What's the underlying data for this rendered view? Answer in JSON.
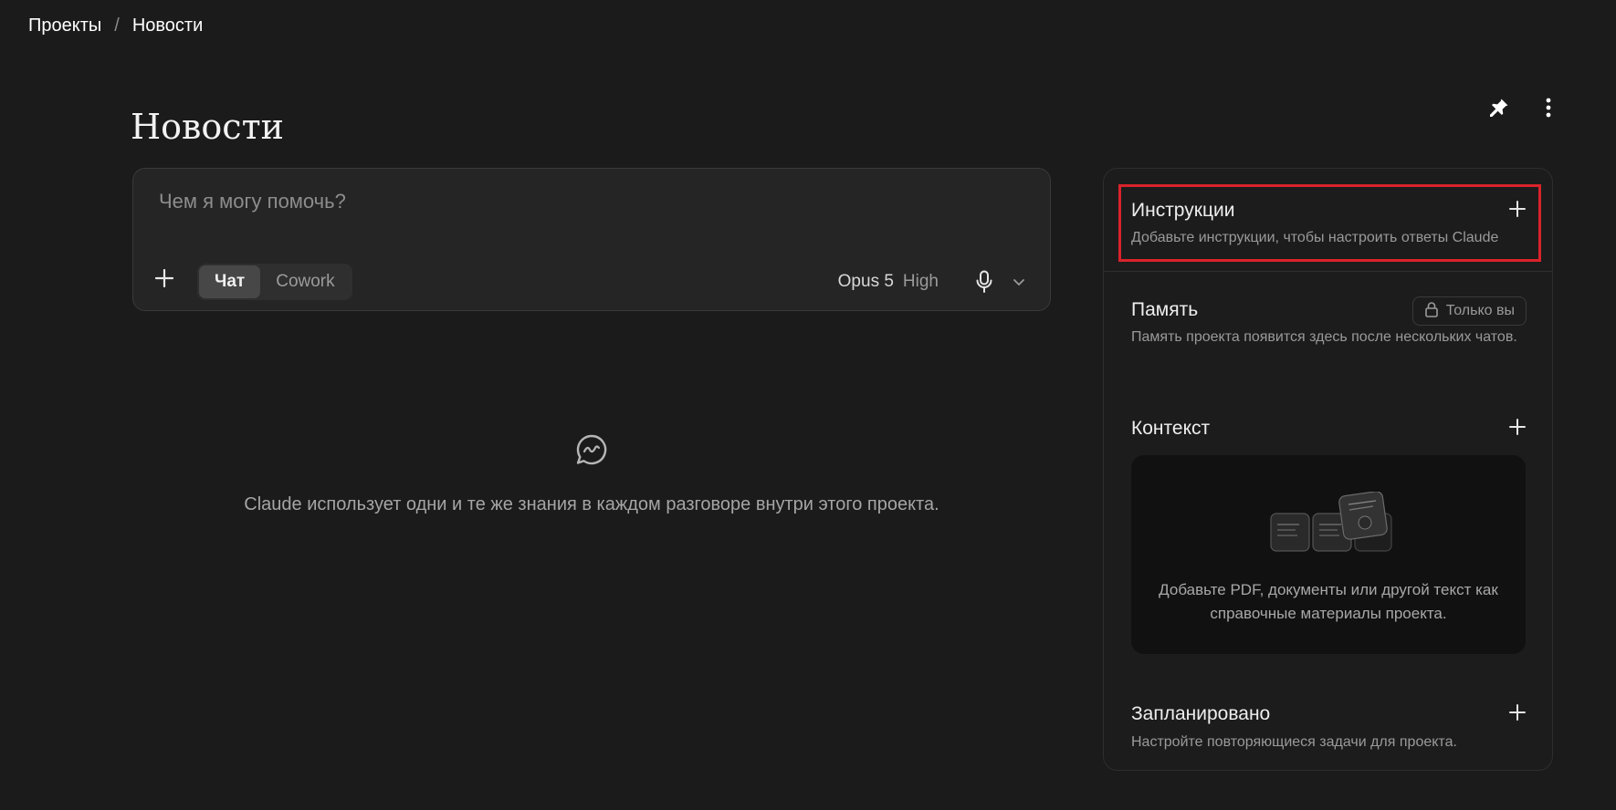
{
  "breadcrumb": {
    "items": [
      "Проекты",
      "Новости"
    ],
    "separator": "/"
  },
  "page": {
    "title": "Новости"
  },
  "header_actions": {
    "pin_icon": "pin-icon",
    "more_icon": "more-vertical-icon"
  },
  "composer": {
    "placeholder": "Чем я могу помочь?",
    "modes": [
      "Чат",
      "Cowork"
    ],
    "active_mode": "Чат",
    "model": "Opus 5",
    "effort": "High"
  },
  "empty_state": {
    "text": "Claude использует одни и те же знания в каждом разговоре внутри этого проекта."
  },
  "panel": {
    "instructions": {
      "title": "Инструкции",
      "description": "Добавьте инструкции, чтобы настроить ответы Claude"
    },
    "memory": {
      "title": "Память",
      "badge": "Только вы",
      "description": "Память проекта появится здесь после нескольких чатов."
    },
    "context": {
      "title": "Контекст",
      "card_text": "Добавьте PDF, документы или другой текст как справочные материалы проекта."
    },
    "scheduled": {
      "title": "Запланировано",
      "description": "Настройте повторяющиеся задачи для проекта."
    }
  },
  "colors": {
    "background": "#1b1b1b",
    "highlight": "#d9232a"
  }
}
